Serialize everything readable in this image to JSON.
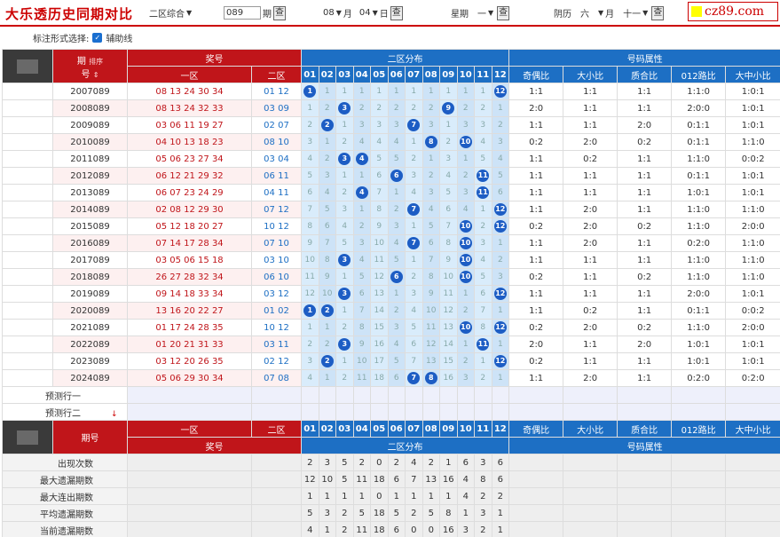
{
  "app_title": "大乐透历史同期对比",
  "controls": {
    "zone_select": "二区综合",
    "issue_value": "089",
    "issue_label": "期",
    "month_value": "08",
    "month_label": "月",
    "day_value": "04",
    "day_label": "日",
    "weekday_label": "星期",
    "weekday_value": "一",
    "lunar_label": "阴历",
    "lunar_month_value": "六",
    "lunar_month_label": "月",
    "lunar_day_value": "十一",
    "query_label": "查"
  },
  "logo_text": "cz89.com",
  "mark_option": {
    "label": "标注形式选择:",
    "checkbox_label": "辅助线",
    "checked": true
  },
  "header": {
    "period": "期号",
    "period_line1": "期",
    "period_line2": "号",
    "sort": "排序",
    "prize": "奖号",
    "zone1": "一区",
    "zone2": "二区",
    "dist": "二区分布",
    "attrs": "号码属性",
    "numbers": [
      "01",
      "02",
      "03",
      "04",
      "05",
      "06",
      "07",
      "08",
      "09",
      "10",
      "11",
      "12"
    ],
    "attr_cols": [
      "奇偶比",
      "大小比",
      "质合比",
      "012路比",
      "大中小比"
    ]
  },
  "rows": [
    {
      "period": "2007089",
      "z1": "08 13 24 30 34",
      "z2": "01 12",
      "dist": [
        "1",
        "1",
        "1",
        "1",
        "1",
        "1",
        "1",
        "1",
        "1",
        "1",
        "1",
        "12"
      ],
      "hits": [
        0,
        11
      ],
      "attrs": [
        "1:1",
        "1:1",
        "1:1",
        "1:1:0",
        "1:0:1"
      ]
    },
    {
      "period": "2008089",
      "z1": "08 13 24 32 33",
      "z2": "03 09",
      "dist": [
        "1",
        "2",
        "3",
        "2",
        "2",
        "2",
        "2",
        "2",
        "9",
        "2",
        "2",
        "1"
      ],
      "hits": [
        2,
        8
      ],
      "attrs": [
        "2:0",
        "1:1",
        "1:1",
        "2:0:0",
        "1:0:1"
      ]
    },
    {
      "period": "2009089",
      "z1": "03 06 11 19 27",
      "z2": "02 07",
      "dist": [
        "2",
        "2",
        "1",
        "3",
        "3",
        "3",
        "7",
        "3",
        "1",
        "3",
        "3",
        "2"
      ],
      "hits": [
        1,
        6
      ],
      "attrs": [
        "1:1",
        "1:1",
        "2:0",
        "0:1:1",
        "1:0:1"
      ]
    },
    {
      "period": "2010089",
      "z1": "04 10 13 18 23",
      "z2": "08 10",
      "dist": [
        "3",
        "1",
        "2",
        "4",
        "4",
        "4",
        "1",
        "8",
        "2",
        "10",
        "4",
        "3"
      ],
      "hits": [
        7,
        9
      ],
      "attrs": [
        "0:2",
        "2:0",
        "0:2",
        "0:1:1",
        "1:1:0"
      ]
    },
    {
      "period": "2011089",
      "z1": "05 06 23 27 34",
      "z2": "03 04",
      "dist": [
        "4",
        "2",
        "3",
        "4",
        "5",
        "5",
        "2",
        "1",
        "3",
        "1",
        "5",
        "4"
      ],
      "hits": [
        2,
        3
      ],
      "attrs": [
        "1:1",
        "0:2",
        "1:1",
        "1:1:0",
        "0:0:2"
      ]
    },
    {
      "period": "2012089",
      "z1": "06 12 21 29 32",
      "z2": "06 11",
      "dist": [
        "5",
        "3",
        "1",
        "1",
        "6",
        "6",
        "3",
        "2",
        "4",
        "2",
        "11",
        "5"
      ],
      "hits": [
        5,
        10
      ],
      "attrs": [
        "1:1",
        "1:1",
        "1:1",
        "0:1:1",
        "1:0:1"
      ]
    },
    {
      "period": "2013089",
      "z1": "06 07 23 24 29",
      "z2": "04 11",
      "dist": [
        "6",
        "4",
        "2",
        "4",
        "7",
        "1",
        "4",
        "3",
        "5",
        "3",
        "11",
        "6"
      ],
      "hits": [
        3,
        10
      ],
      "attrs": [
        "1:1",
        "1:1",
        "1:1",
        "1:0:1",
        "1:0:1"
      ]
    },
    {
      "period": "2014089",
      "z1": "02 08 12 29 30",
      "z2": "07 12",
      "dist": [
        "7",
        "5",
        "3",
        "1",
        "8",
        "2",
        "7",
        "4",
        "6",
        "4",
        "1",
        "12"
      ],
      "hits": [
        6,
        11
      ],
      "attrs": [
        "1:1",
        "2:0",
        "1:1",
        "1:1:0",
        "1:1:0"
      ]
    },
    {
      "period": "2015089",
      "z1": "05 12 18 20 27",
      "z2": "10 12",
      "dist": [
        "8",
        "6",
        "4",
        "2",
        "9",
        "3",
        "1",
        "5",
        "7",
        "10",
        "2",
        "12"
      ],
      "hits": [
        9,
        11
      ],
      "attrs": [
        "0:2",
        "2:0",
        "0:2",
        "1:1:0",
        "2:0:0"
      ]
    },
    {
      "period": "2016089",
      "z1": "07 14 17 28 34",
      "z2": "07 10",
      "dist": [
        "9",
        "7",
        "5",
        "3",
        "10",
        "4",
        "7",
        "6",
        "8",
        "10",
        "3",
        "1"
      ],
      "hits": [
        6,
        9
      ],
      "attrs": [
        "1:1",
        "2:0",
        "1:1",
        "0:2:0",
        "1:1:0"
      ]
    },
    {
      "period": "2017089",
      "z1": "03 05 06 15 18",
      "z2": "03 10",
      "dist": [
        "10",
        "8",
        "3",
        "4",
        "11",
        "5",
        "1",
        "7",
        "9",
        "10",
        "4",
        "2"
      ],
      "hits": [
        2,
        9
      ],
      "attrs": [
        "1:1",
        "1:1",
        "1:1",
        "1:1:0",
        "1:1:0"
      ]
    },
    {
      "period": "2018089",
      "z1": "26 27 28 32 34",
      "z2": "06 10",
      "dist": [
        "11",
        "9",
        "1",
        "5",
        "12",
        "6",
        "2",
        "8",
        "10",
        "10",
        "5",
        "3"
      ],
      "hits": [
        5,
        9
      ],
      "attrs": [
        "0:2",
        "1:1",
        "0:2",
        "1:1:0",
        "1:1:0"
      ]
    },
    {
      "period": "2019089",
      "z1": "09 14 18 33 34",
      "z2": "03 12",
      "dist": [
        "12",
        "10",
        "3",
        "6",
        "13",
        "1",
        "3",
        "9",
        "11",
        "1",
        "6",
        "12"
      ],
      "hits": [
        2,
        11
      ],
      "attrs": [
        "1:1",
        "1:1",
        "1:1",
        "2:0:0",
        "1:0:1"
      ]
    },
    {
      "period": "2020089",
      "z1": "13 16 20 22 27",
      "z2": "01 02",
      "dist": [
        "1",
        "2",
        "1",
        "7",
        "14",
        "2",
        "4",
        "10",
        "12",
        "2",
        "7",
        "1"
      ],
      "hits": [
        0,
        1
      ],
      "attrs": [
        "1:1",
        "0:2",
        "1:1",
        "0:1:1",
        "0:0:2"
      ]
    },
    {
      "period": "2021089",
      "z1": "01 17 24 28 35",
      "z2": "10 12",
      "dist": [
        "1",
        "1",
        "2",
        "8",
        "15",
        "3",
        "5",
        "11",
        "13",
        "10",
        "8",
        "12"
      ],
      "hits": [
        9,
        11
      ],
      "attrs": [
        "0:2",
        "2:0",
        "0:2",
        "1:1:0",
        "2:0:0"
      ]
    },
    {
      "period": "2022089",
      "z1": "01 20 21 31 33",
      "z2": "03 11",
      "dist": [
        "2",
        "2",
        "3",
        "9",
        "16",
        "4",
        "6",
        "12",
        "14",
        "1",
        "11",
        "1"
      ],
      "hits": [
        2,
        10
      ],
      "attrs": [
        "2:0",
        "1:1",
        "2:0",
        "1:0:1",
        "1:0:1"
      ]
    },
    {
      "period": "2023089",
      "z1": "03 12 20 26 35",
      "z2": "02 12",
      "dist": [
        "3",
        "2",
        "1",
        "10",
        "17",
        "5",
        "7",
        "13",
        "15",
        "2",
        "1",
        "12"
      ],
      "hits": [
        1,
        11
      ],
      "attrs": [
        "0:2",
        "1:1",
        "1:1",
        "1:0:1",
        "1:0:1"
      ]
    },
    {
      "period": "2024089",
      "z1": "05 06 29 30 34",
      "z2": "07 08",
      "dist": [
        "4",
        "1",
        "2",
        "11",
        "18",
        "6",
        "7",
        "8",
        "16",
        "3",
        "2",
        "1"
      ],
      "hits": [
        6,
        7
      ],
      "attrs": [
        "1:1",
        "2:0",
        "1:1",
        "0:2:0",
        "0:2:0"
      ]
    }
  ],
  "predict": [
    "预测行一",
    "预测行二"
  ],
  "stats": [
    {
      "label": "出现次数",
      "values": [
        "2",
        "3",
        "5",
        "2",
        "0",
        "2",
        "4",
        "2",
        "1",
        "6",
        "3",
        "6"
      ]
    },
    {
      "label": "最大遗漏期数",
      "values": [
        "12",
        "10",
        "5",
        "11",
        "18",
        "6",
        "7",
        "13",
        "16",
        "4",
        "8",
        "6"
      ]
    },
    {
      "label": "最大连出期数",
      "values": [
        "1",
        "1",
        "1",
        "1",
        "0",
        "1",
        "1",
        "1",
        "1",
        "4",
        "2",
        "2"
      ]
    },
    {
      "label": "平均遗漏期数",
      "values": [
        "5",
        "3",
        "2",
        "5",
        "18",
        "5",
        "2",
        "5",
        "8",
        "1",
        "3",
        "1"
      ]
    },
    {
      "label": "当前遗漏期数",
      "values": [
        "4",
        "1",
        "2",
        "11",
        "18",
        "6",
        "0",
        "0",
        "16",
        "3",
        "2",
        "1"
      ]
    }
  ]
}
